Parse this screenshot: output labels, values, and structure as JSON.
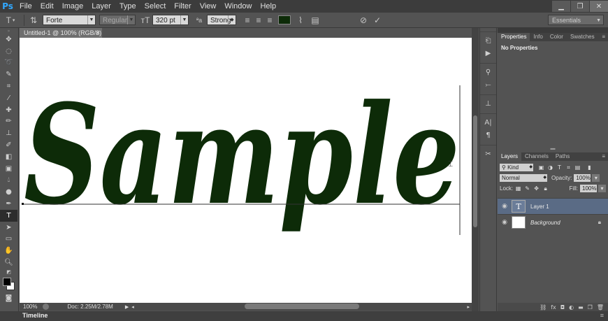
{
  "app": {
    "logo": "Ps"
  },
  "menu": [
    "File",
    "Edit",
    "Image",
    "Layer",
    "Type",
    "Select",
    "Filter",
    "View",
    "Window",
    "Help"
  ],
  "window_controls": {
    "minimize": "▁",
    "restore": "❐",
    "close": "✕"
  },
  "options_bar": {
    "font_family": "Forte",
    "font_style": "Regular",
    "font_size": "320 pt",
    "antialias_label": "ªa",
    "antialias": "Strong",
    "text_color": "#0d2b08",
    "workspace": "Essentials"
  },
  "document": {
    "tab_title": "Untitled-1 @ 100% (RGB/8)",
    "tab_close": "×",
    "sample_text": "Sample",
    "text_color": "#0d2b08"
  },
  "status": {
    "zoom": "100%",
    "doc_size": "Doc: 2.25M/2.78M"
  },
  "timeline": {
    "label": "Timeline"
  },
  "properties": {
    "tabs": [
      "Properties",
      "Info",
      "Color",
      "Swatches"
    ],
    "message": "No Properties"
  },
  "layers": {
    "tabs": [
      "Layers",
      "Channels",
      "Paths"
    ],
    "filter_kind": "Kind",
    "blend_mode": "Normal",
    "opacity_label": "Opacity:",
    "opacity": "100%",
    "lock_label": "Lock:",
    "fill_label": "Fill:",
    "fill": "100%",
    "items": [
      {
        "name": "Layer 1",
        "thumb": "T"
      },
      {
        "name": "Background"
      }
    ]
  }
}
